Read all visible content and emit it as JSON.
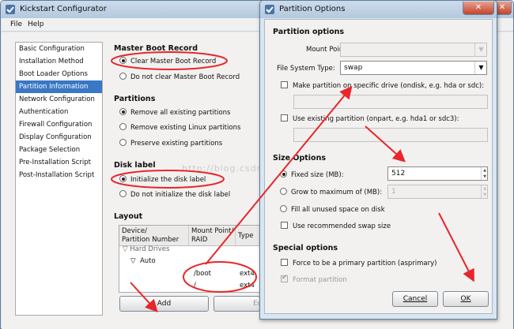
{
  "main_window": {
    "title": "Kickstart Configurator",
    "minimize": "–",
    "maximize": "□",
    "close": "✕"
  },
  "menu": {
    "file": "File",
    "help": "Help"
  },
  "sidebar": {
    "items": [
      {
        "label": "Basic Configuration"
      },
      {
        "label": "Installation Method"
      },
      {
        "label": "Boot Loader Options"
      },
      {
        "label": "Partition Information"
      },
      {
        "label": "Network Configuration"
      },
      {
        "label": "Authentication"
      },
      {
        "label": "Firewall Configuration"
      },
      {
        "label": "Display Configuration"
      },
      {
        "label": "Package Selection"
      },
      {
        "label": "Pre-Installation Script"
      },
      {
        "label": "Post-Installation Script"
      }
    ],
    "selected_index": 3
  },
  "mbr": {
    "heading": "Master Boot Record",
    "clear": "Clear Master Boot Record",
    "noclear": "Do not clear Master Boot Record"
  },
  "partitions": {
    "heading": "Partitions",
    "remove_all": "Remove all existing partitions",
    "remove_linux": "Remove existing Linux partitions",
    "preserve": "Preserve existing partitions"
  },
  "disklabel": {
    "heading": "Disk label",
    "init": "Initialize the disk label",
    "noinit": "Do not initialize the disk label"
  },
  "layout": {
    "heading": "Layout",
    "col_device": "Device/\nPartition Number",
    "col_mount": "Mount Point/\nRAID",
    "col_type": "Type",
    "hard_drives": "Hard Drives",
    "auto": "Auto",
    "rows": [
      {
        "mount": "/boot",
        "type": "ext4"
      },
      {
        "mount": "/",
        "type": "ext4"
      }
    ],
    "add_button": "Add",
    "edit_button_partial": "Ed"
  },
  "dialog": {
    "title": "Partition Options",
    "close": "✕",
    "partition_options_heading": "Partition options",
    "mount_point_label": "Mount Point:",
    "mount_point_value": "",
    "fs_type_label": "File System Type:",
    "fs_type_value": "swap",
    "ondisk_label": "Make partition on specific drive (ondisk, e.g. hda or sdc):",
    "ondisk_value": "",
    "onpart_label": "Use existing partition (onpart, e.g. hda1 or sdc3):",
    "onpart_value": "",
    "size_heading": "Size Options",
    "fixed_label": "Fixed size (MB):",
    "fixed_value": "512",
    "grow_label": "Grow to maximum of (MB):",
    "grow_value": "1",
    "fill_label": "Fill all unused space on disk",
    "recommended_label": "Use recommended swap size",
    "special_heading": "Special options",
    "primary_label": "Force to be a primary partition (asprimary)",
    "format_label": "Format partition",
    "cancel_button": "Cancel",
    "ok_button": "OK"
  },
  "watermark": "http://blog.csdn.net/p___16",
  "colors": {
    "annotation_red": "#e8262b",
    "selection_blue": "#3a77c4",
    "titlebar": "#c0d3e6"
  }
}
